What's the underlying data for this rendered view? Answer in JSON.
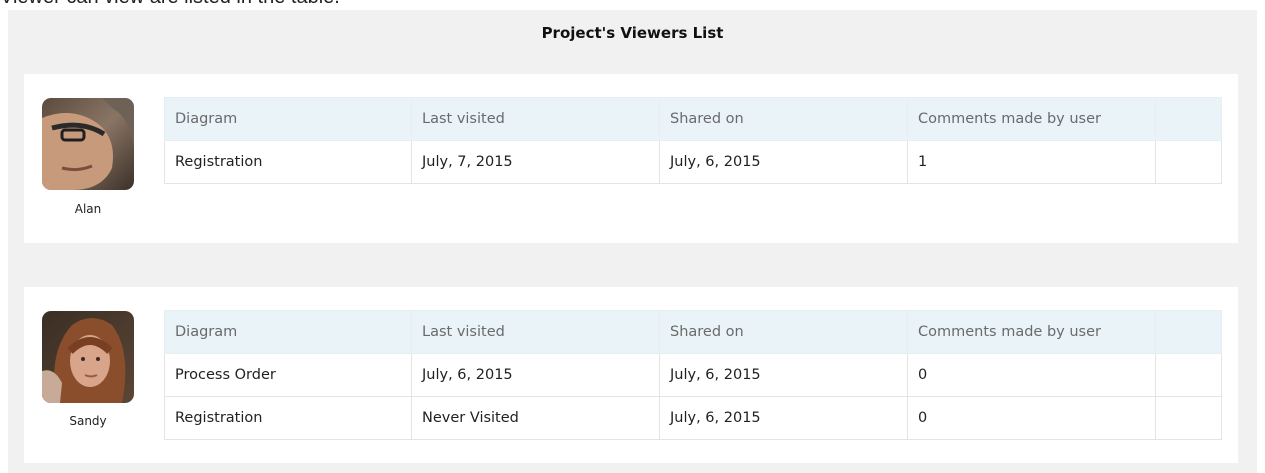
{
  "intro": "Viewer can view are listed in the table.",
  "panel": {
    "title": "Project's Viewers List"
  },
  "columns": [
    "Diagram",
    "Last visited",
    "Shared on",
    "Comments made by user",
    ""
  ],
  "viewers": [
    {
      "name": "Alan",
      "avatar_icon": "user-photo-alan",
      "rows": [
        {
          "diagram": "Registration",
          "last_visited": "July, 7, 2015",
          "shared_on": "July, 6, 2015",
          "comments": "1"
        }
      ]
    },
    {
      "name": "Sandy",
      "avatar_icon": "user-photo-sandy",
      "rows": [
        {
          "diagram": "Process Order",
          "last_visited": "July, 6, 2015",
          "shared_on": "July, 6, 2015",
          "comments": "0"
        },
        {
          "diagram": "Registration",
          "last_visited": "Never Visited",
          "shared_on": "July, 6, 2015",
          "comments": "0"
        }
      ]
    }
  ],
  "colors": {
    "panel_bg": "#f1f1f1",
    "header_bg": "#eaf4f8",
    "border": "#e4e4e4"
  }
}
